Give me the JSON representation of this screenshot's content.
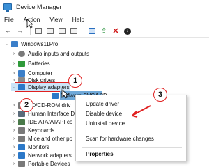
{
  "window": {
    "title": "Device Manager"
  },
  "menu": [
    "File",
    "Action",
    "View",
    "Help"
  ],
  "toolbar": {
    "icons": [
      "back-arrow-icon",
      "forward-arrow-icon",
      "properties-icon",
      "view-icon",
      "help-icon",
      "device-icon",
      "scan-icon",
      "update-driver-icon",
      "uninstall-icon",
      "disable-icon"
    ]
  },
  "tree": {
    "root": "Windows11Pro",
    "items": [
      {
        "label": "Audio inputs and outputs",
        "expander": "›"
      },
      {
        "label": "Batteries",
        "expander": "›"
      },
      {
        "label": "Computer",
        "expander": "›"
      },
      {
        "label": "Disk drives",
        "expander": "›"
      },
      {
        "label": "Display adapters",
        "expander": "⌄"
      },
      {
        "label": "VMware SVGA 3D",
        "expander": ""
      },
      {
        "label": "VD/CD-ROM driv",
        "expander": "›"
      },
      {
        "label": "Human Interface D",
        "expander": "›"
      },
      {
        "label": "IDE ATA/ATAPI co",
        "expander": "›"
      },
      {
        "label": "Keyboards",
        "expander": "›"
      },
      {
        "label": "Mice and other po",
        "expander": "›"
      },
      {
        "label": "Monitors",
        "expander": "›"
      },
      {
        "label": "Network adapters",
        "expander": "›"
      },
      {
        "label": "Portable Devices",
        "expander": "›"
      }
    ]
  },
  "context_menu": {
    "items": [
      {
        "label": "Update driver"
      },
      {
        "label": "Disable device"
      },
      {
        "label": "Uninstall device"
      },
      {
        "label": "Scan for hardware changes"
      },
      {
        "label": "Properties"
      }
    ]
  },
  "badges": [
    "1",
    "2",
    "3"
  ],
  "colors": {
    "accent": "#e02020",
    "selection": "#cce4f7",
    "child_selection": "#6ea8d8"
  }
}
